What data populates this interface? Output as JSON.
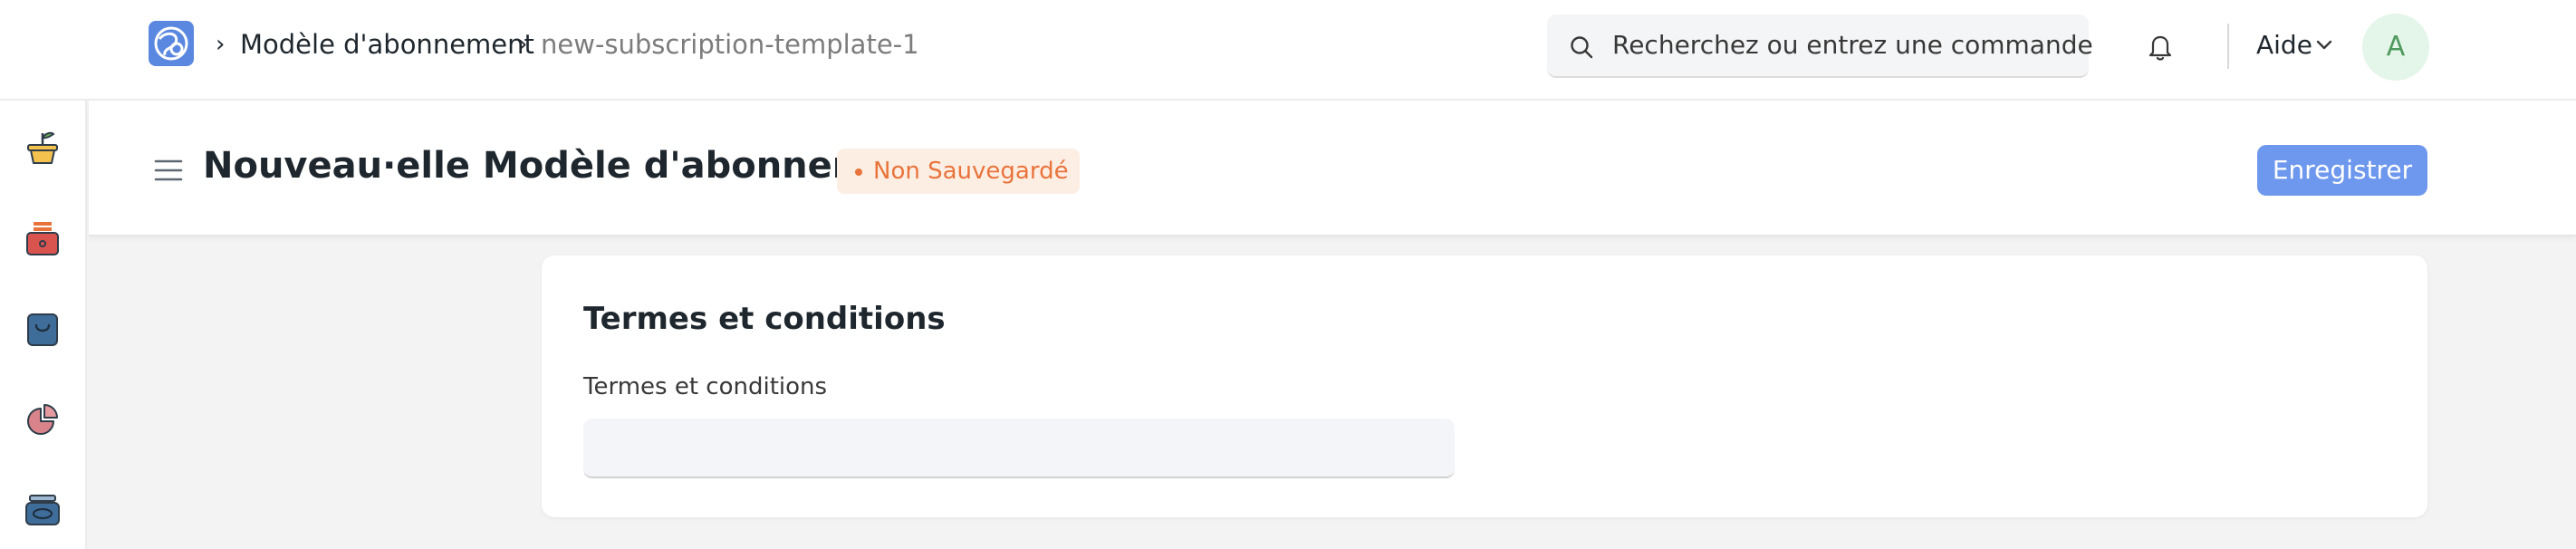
{
  "breadcrumb": {
    "items": [
      "Modèle d'abonnement",
      "new-subscription-template-1"
    ]
  },
  "search": {
    "placeholder": "Recherchez ou entrez une commande"
  },
  "navbar": {
    "help_label": "Aide",
    "avatar_initial": "A"
  },
  "sidebar": {
    "icons": [
      "plant-pot-icon",
      "cash-register-icon",
      "shopping-bag-icon",
      "pie-chart-icon",
      "tray-icon"
    ]
  },
  "page": {
    "title": "Nouveau·elle Modèle d'abonnement",
    "status_badge": "Non Sauvegardé",
    "save_label": "Enregistrer"
  },
  "form": {
    "section_title": "Termes et conditions",
    "field_label": "Termes et conditions",
    "field_value": ""
  },
  "colors": {
    "primary_button": "#6e98ee",
    "badge_text": "#e8743b",
    "badge_bg": "#fdeee4",
    "avatar_bg": "#e4f5e9",
    "avatar_text": "#4f9a5f",
    "logo_bg": "#5a87e0"
  }
}
